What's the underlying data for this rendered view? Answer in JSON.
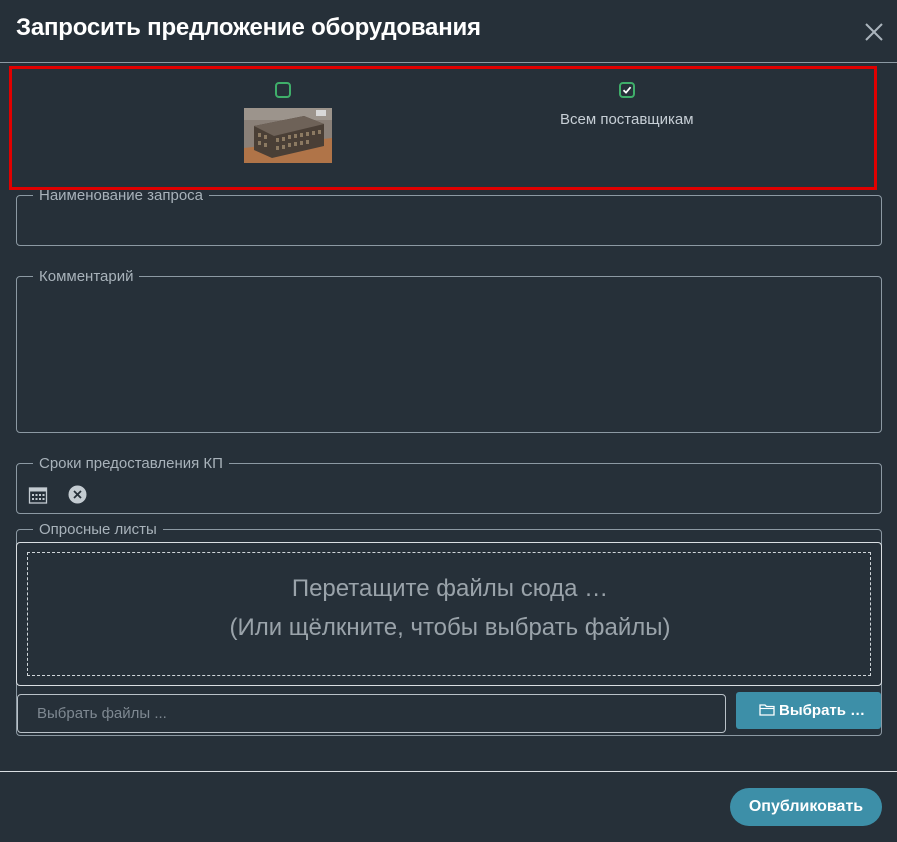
{
  "dialog": {
    "title": "Запросить предложение оборудования"
  },
  "recipients": {
    "object_checked": false,
    "all_suppliers_checked": true,
    "all_suppliers_label": "Всем поставщикам"
  },
  "fields": {
    "name_legend": "Наименование запроса",
    "name_value": "",
    "comment_legend": "Комментарий",
    "comment_value": "",
    "deadline_legend": "Сроки предоставления КП",
    "files_legend": "Опросные листы"
  },
  "dropzone": {
    "line1": "Перетащите файлы сюда …",
    "line2": "(Или щёлкните, чтобы выбрать файлы)"
  },
  "file_picker": {
    "placeholder": "Выбрать файлы ...",
    "button_label": "Выбрать …"
  },
  "footer": {
    "publish_label": "Опубликовать"
  },
  "colors": {
    "background": "#263039",
    "accent": "#3d8fa8",
    "checkbox": "#3fae6a",
    "highlight": "#e00000"
  }
}
